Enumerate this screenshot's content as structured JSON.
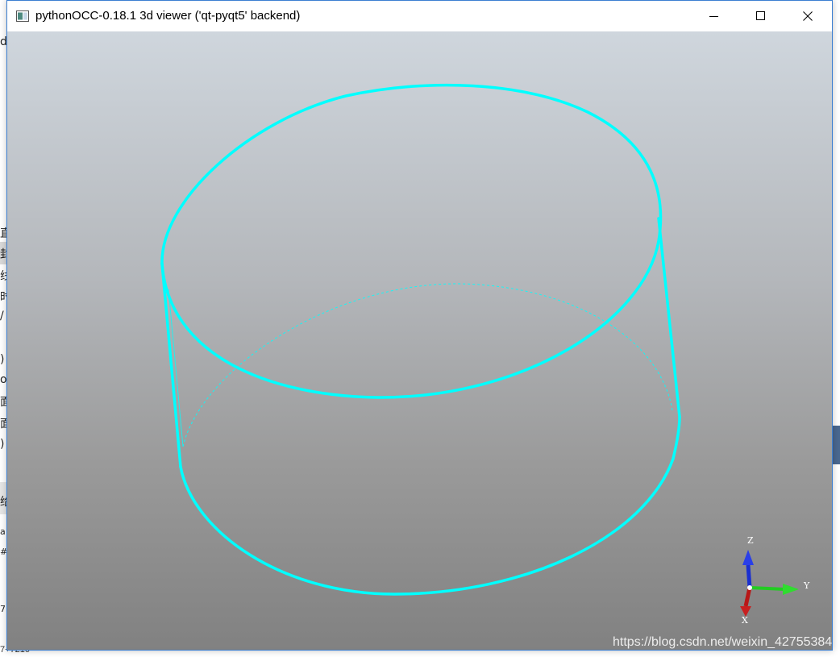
{
  "window": {
    "title": "pythonOCC-0.18.1 3d viewer ('qt-pyqt5' backend)"
  },
  "background_fragments": {
    "glyphs": [
      "d",
      "直",
      "封",
      "线",
      "时",
      "/",
      ")",
      "o",
      "面",
      "面",
      ")",
      "给",
      "a",
      "#",
      "7"
    ],
    "bottom_text": "7+7210"
  },
  "triedron": {
    "z_label": "Z",
    "y_label": "Y",
    "x_label": "X"
  },
  "watermark": "https://blog.csdn.net/weixin_42755384",
  "colors": {
    "wire": "#00ffff",
    "axis_z": "#1a2fd0",
    "axis_y": "#22cc22",
    "axis_x": "#c01818"
  }
}
